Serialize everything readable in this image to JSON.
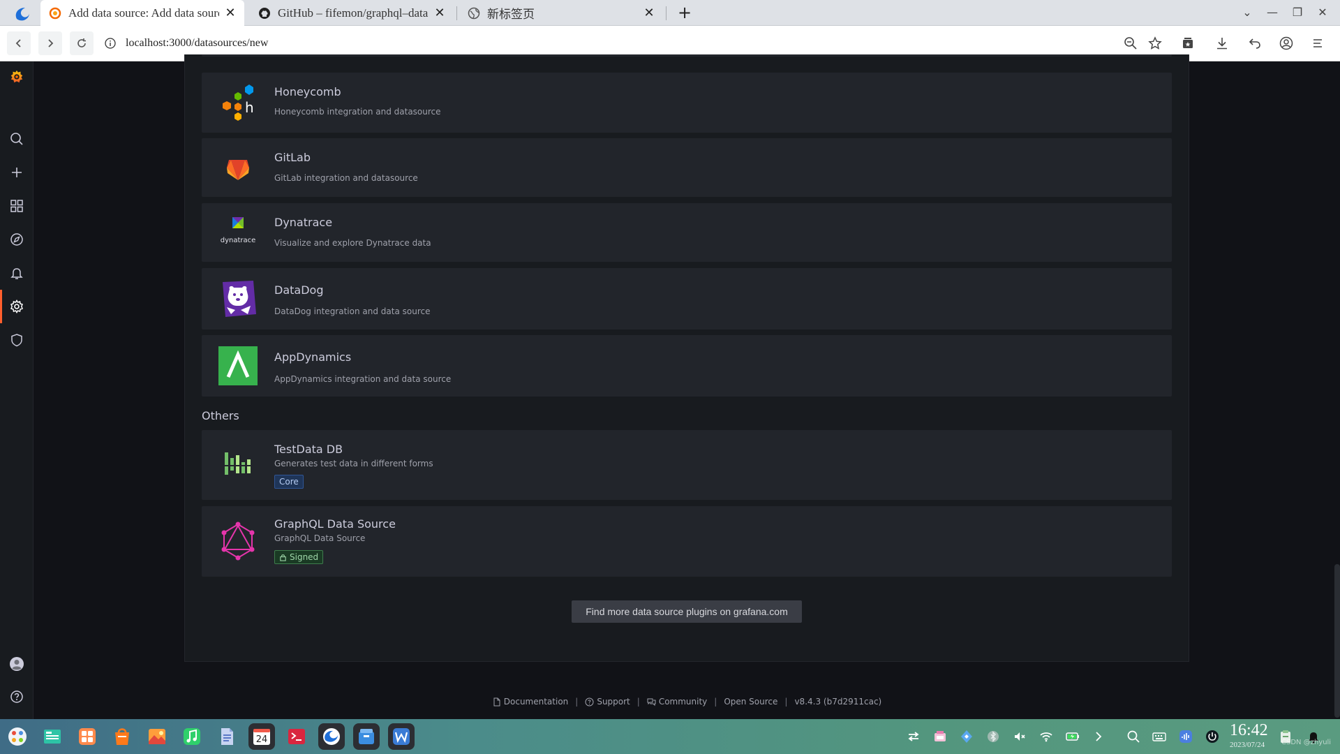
{
  "browser": {
    "tabs": [
      {
        "title": "Add  data  source:  Add  data  source",
        "active": true,
        "icon": "grafana-icon"
      },
      {
        "title": "GitHub  –  fifemon/graphql–datasource",
        "active": false,
        "icon": "github-icon"
      },
      {
        "title": "新标签页",
        "active": false,
        "icon": "globe-icon"
      }
    ],
    "url": "localhost:3000/datasources/new"
  },
  "datasources": {
    "monitoring": [
      {
        "name": "Honeycomb",
        "description": "Honeycomb integration and datasource",
        "logo": "honeycomb-logo"
      },
      {
        "name": "GitLab",
        "description": "GitLab integration and datasource",
        "logo": "gitlab-logo"
      },
      {
        "name": "Dynatrace",
        "description": "Visualize and explore Dynatrace data",
        "logo": "dynatrace-logo",
        "logo_text": "dynatrace"
      },
      {
        "name": "DataDog",
        "description": "DataDog integration and data source",
        "logo": "datadog-logo"
      },
      {
        "name": "AppDynamics",
        "description": "AppDynamics integration and data source",
        "logo": "appdynamics-logo"
      }
    ],
    "others_title": "Others",
    "others": [
      {
        "name": "TestData DB",
        "description": "Generates test data in different forms",
        "badge": "Core",
        "logo": "testdata-logo"
      },
      {
        "name": "GraphQL Data Source",
        "description": "GraphQL Data Source",
        "badge": "Signed",
        "logo": "graphql-logo"
      }
    ],
    "find_more": "Find more data source plugins on grafana.com"
  },
  "footer": {
    "documentation": "Documentation",
    "support": "Support",
    "community": "Community",
    "open_source": "Open Source",
    "version": "v8.4.3 (b7d2911cac)"
  },
  "taskbar": {
    "calendar_day": "24",
    "time": "16:42",
    "date": "2023/07/24",
    "watermark": "CSDN @zhyuli"
  },
  "colors": {
    "grafana_orange": "#ff5f2d",
    "panel_bg": "#181b1f",
    "card_bg": "#22252b"
  }
}
